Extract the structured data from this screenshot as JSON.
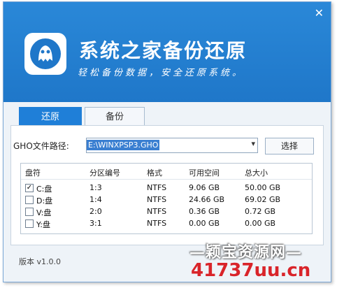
{
  "header": {
    "title": "系统之家备份还原",
    "subtitle": "轻松备份数据，安全还原系统。",
    "close_glyph": "✕"
  },
  "tabs": [
    {
      "label": "还原",
      "active": true
    },
    {
      "label": "备份",
      "active": false
    }
  ],
  "path": {
    "label": "GHO文件路径:",
    "value": "E:\\WINXPSP3.GHO",
    "arrow_glyph": "▾",
    "browse_label": "选择"
  },
  "table": {
    "headers": [
      "盘符",
      "分区编号",
      "格式",
      "可用空间",
      "总大小"
    ],
    "rows": [
      {
        "checked": true,
        "drive": "C:盘",
        "partition": "1:3",
        "format": "NTFS",
        "free": "9.06 GB",
        "total": "50.00 GB"
      },
      {
        "checked": false,
        "drive": "D:盘",
        "partition": "1:4",
        "format": "NTFS",
        "free": "24.66 GB",
        "total": "69.02 GB"
      },
      {
        "checked": false,
        "drive": "V:盘",
        "partition": "2:0",
        "format": "NTFS",
        "free": "0.36 GB",
        "total": "0.72 GB"
      },
      {
        "checked": false,
        "drive": "Y:盘",
        "partition": "3:1",
        "format": "NTFS",
        "free": "0.00 GB",
        "total": "0.00 GB"
      }
    ]
  },
  "footer": {
    "version": "版本 v1.0.0"
  },
  "watermark": {
    "line1": "—颖宝资源网—",
    "line2_prefix": "417",
    "line2_main": "37uu.cn"
  },
  "colors": {
    "header_blue": "#1f77c9",
    "tab_active": "#1f7fd8"
  }
}
